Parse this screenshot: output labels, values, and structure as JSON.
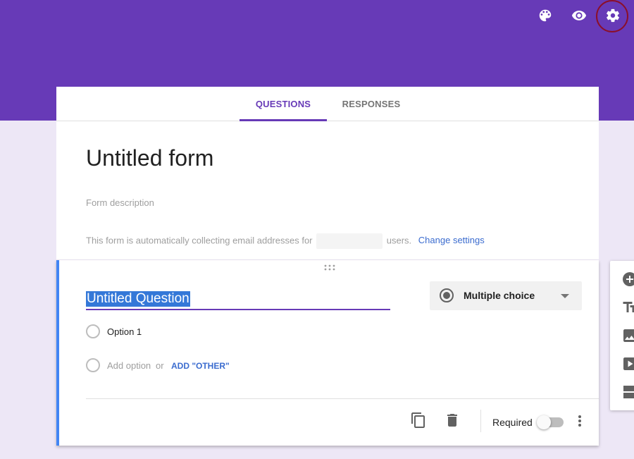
{
  "header": {
    "icons": [
      "palette-icon",
      "eye-icon",
      "gear-icon"
    ],
    "bg_color": "#673ab7"
  },
  "tabs": [
    {
      "label": "QUESTIONS",
      "active": true
    },
    {
      "label": "RESPONSES",
      "active": false
    }
  ],
  "form": {
    "title": "Untitled form",
    "description_placeholder": "Form description",
    "email_note": "This form is automatically collecting email addresses for",
    "email_note_suffix": "users.",
    "change_settings": "Change settings"
  },
  "question": {
    "title": "Untitled Question",
    "type": "Multiple choice",
    "options": [
      {
        "label": "Option 1"
      }
    ],
    "add_option": "Add option",
    "or_text": "or",
    "add_other": "ADD \"OTHER\"",
    "required_label": "Required",
    "required": false
  },
  "side_toolbar": [
    "add-question-icon",
    "add-title-icon",
    "add-image-icon",
    "add-video-icon",
    "add-section-icon"
  ],
  "colors": {
    "accent": "#673ab7",
    "page_bg": "#ede7f6",
    "link": "#3b6ccf",
    "focus_bar": "#4285f4"
  }
}
